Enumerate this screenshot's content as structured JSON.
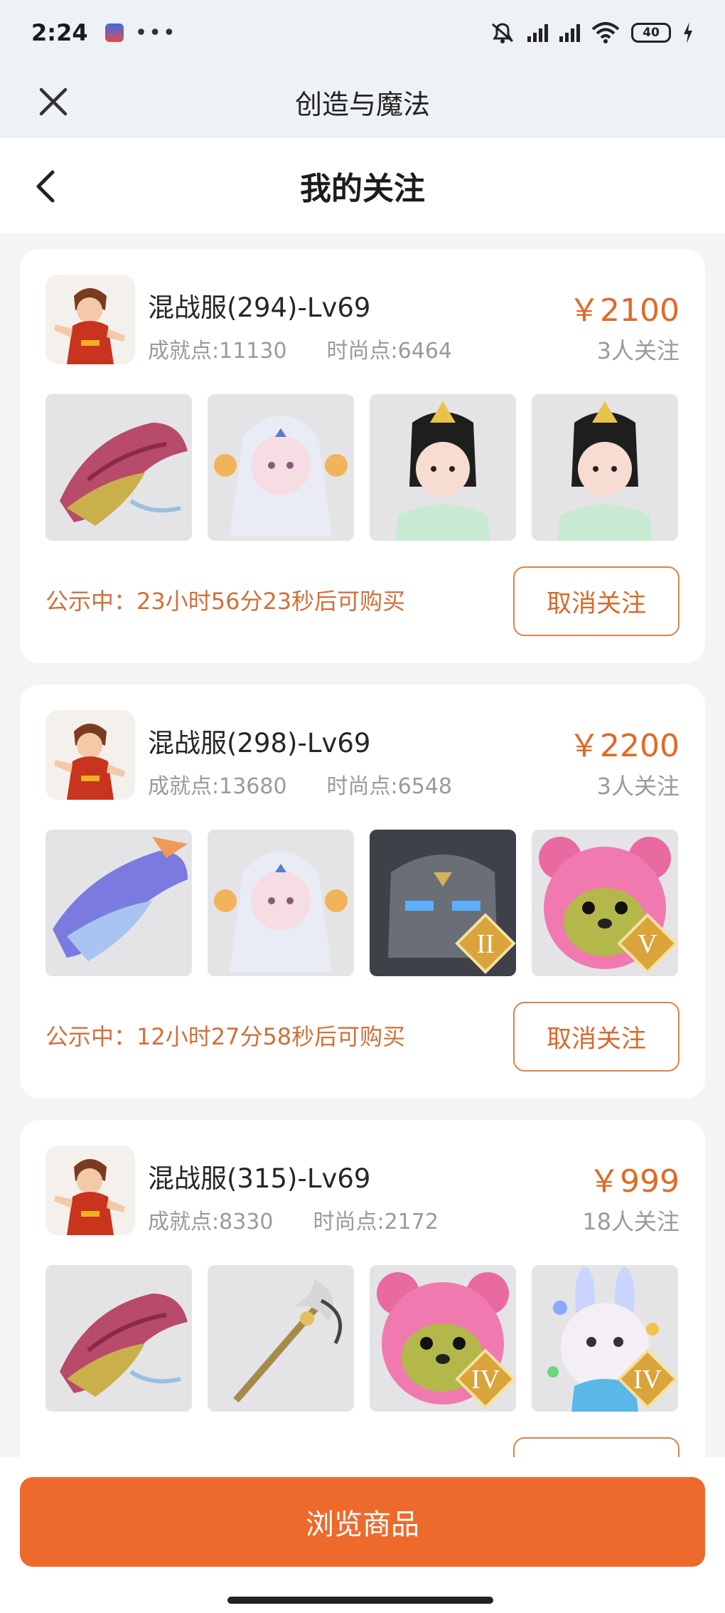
{
  "status_bar": {
    "time": "2:24",
    "more": "•••",
    "battery": "40"
  },
  "webview": {
    "title": "创造与魔法"
  },
  "page": {
    "title": "我的关注"
  },
  "colors": {
    "accent": "#ee6a2c",
    "price": "#e06a25",
    "notice": "#d0703a"
  },
  "listings": [
    {
      "server": "混战服(294)-Lv69",
      "achievement": "成就点:11130",
      "fashion": "时尚点:6464",
      "price": "￥2100",
      "followers": "3人关注",
      "notice": "公示中：23小时56分23秒后可购买",
      "unfollow_label": "取消关注",
      "thumbs": [
        {
          "name": "crimson-dragon-mount",
          "badge": ""
        },
        {
          "name": "white-haired-girl-outfit",
          "badge": ""
        },
        {
          "name": "black-haired-girl-outfit",
          "badge": ""
        },
        {
          "name": "black-haired-girl-outfit",
          "badge": ""
        }
      ]
    },
    {
      "server": "混战服(298)-Lv69",
      "achievement": "成就点:13680",
      "fashion": "时尚点:6548",
      "price": "￥2200",
      "followers": "3人关注",
      "notice": "公示中：12小时27分58秒后可购买",
      "unfollow_label": "取消关注",
      "thumbs": [
        {
          "name": "blue-dragon-mount",
          "badge": ""
        },
        {
          "name": "white-haired-girl-outfit",
          "badge": ""
        },
        {
          "name": "stone-golem-pet",
          "badge": "II"
        },
        {
          "name": "pink-bear-pet",
          "badge": "V"
        }
      ]
    },
    {
      "server": "混战服(315)-Lv69",
      "achievement": "成就点:8330",
      "fashion": "时尚点:2172",
      "price": "￥999",
      "followers": "18人关注",
      "notice": "",
      "unfollow_label": "",
      "thumbs": [
        {
          "name": "crimson-dragon-mount",
          "badge": ""
        },
        {
          "name": "ornate-staff-weapon",
          "badge": ""
        },
        {
          "name": "pink-bear-pet",
          "badge": "IV"
        },
        {
          "name": "white-bunny-pet",
          "badge": "IV"
        }
      ]
    }
  ],
  "bottom": {
    "browse_label": "浏览商品"
  }
}
